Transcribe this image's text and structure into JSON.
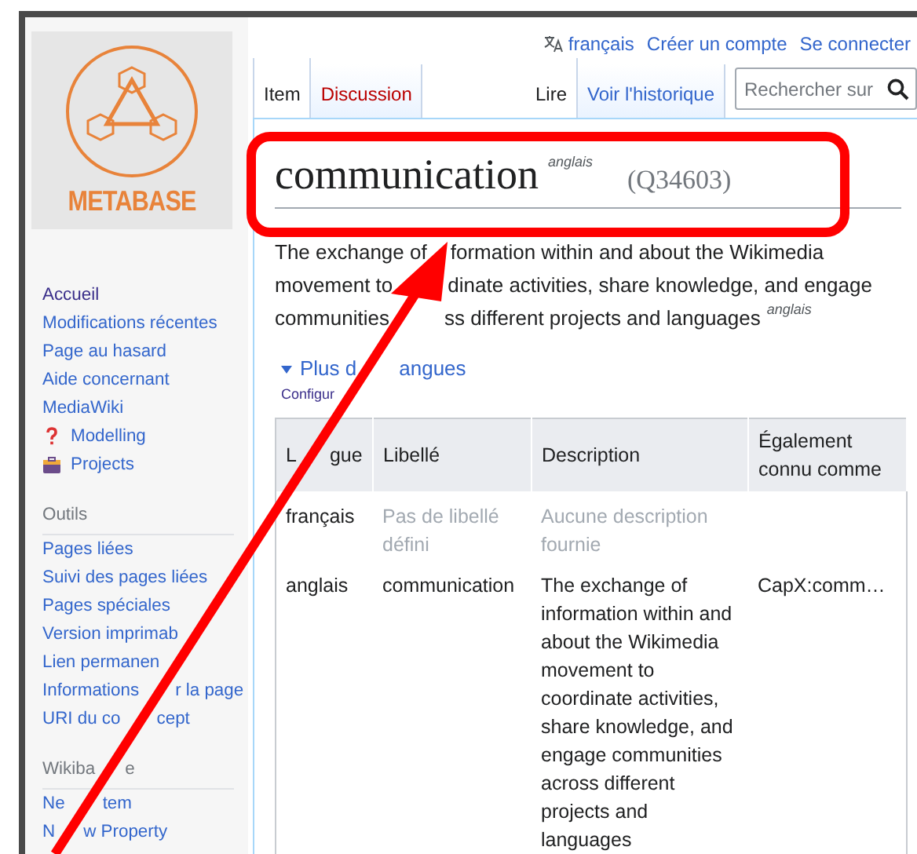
{
  "header_links": [
    {
      "kind": "language",
      "label": "français"
    },
    {
      "kind": "link",
      "label": "Créer un compte"
    },
    {
      "kind": "link",
      "label": "Se connecter"
    }
  ],
  "logo": {
    "text": "METABASE"
  },
  "sidebar": {
    "navigation": [
      {
        "label": "Accueil",
        "visited": true,
        "kind": "link"
      },
      {
        "label": "Modifications récentes",
        "visited": false,
        "kind": "link"
      },
      {
        "label": "Page au hasard",
        "visited": false,
        "kind": "link"
      },
      {
        "label": "Aide concernant MediaWiki",
        "visited": false,
        "kind": "link"
      },
      {
        "label": "Modelling",
        "visited": false,
        "kind": "question"
      },
      {
        "label": "Projects",
        "visited": false,
        "kind": "toolbox"
      }
    ],
    "sections": [
      {
        "title": {
          "parts": [
            "Outils"
          ]
        },
        "items": [
          {
            "parts": [
              "Pages liées"
            ]
          },
          {
            "parts": [
              "Suivi des pages liées"
            ]
          },
          {
            "parts": [
              "Pages spéciales"
            ]
          },
          {
            "parts": [
              "Version imprimab"
            ]
          },
          {
            "parts": [
              "Lien permanen"
            ]
          },
          {
            "parts": [
              "Informations",
              "r la page"
            ]
          },
          {
            "parts": [
              "URI du co",
              "cept"
            ]
          }
        ]
      },
      {
        "title": {
          "parts": [
            "Wikiba",
            "e"
          ]
        },
        "items": [
          {
            "parts": [
              "Ne",
              "tem"
            ]
          },
          {
            "parts": [
              "N",
              "w Property"
            ]
          }
        ]
      }
    ]
  },
  "tabs_left": [
    {
      "label": "Item",
      "selected": true,
      "missing": false
    },
    {
      "label": "Discussion",
      "selected": false,
      "missing": true
    }
  ],
  "tabs_right": [
    {
      "label": "Lire",
      "selected": true
    },
    {
      "label": "Voir l'historique",
      "selected": false
    }
  ],
  "search": {
    "placeholder": "Rechercher sur"
  },
  "title": {
    "label": "communication",
    "language": "anglais",
    "id": "(Q34603)"
  },
  "description": {
    "lines": [
      {
        "parts": [
          "The exchange of",
          "formation within and about the Wikimedia"
        ]
      },
      {
        "parts": [
          "movement to",
          "dinate activities, share knowledge, and engage"
        ]
      },
      {
        "parts": [
          "communities",
          "ss different projects and languages"
        ]
      }
    ],
    "language": "anglais"
  },
  "more_languages": {
    "parts": [
      "Plus d",
      "angues"
    ],
    "expanded": true,
    "configure": "Configur"
  },
  "table": {
    "columns": [
      {
        "parts": [
          "L",
          "gue"
        ]
      },
      {
        "parts": [
          "Libellé"
        ]
      },
      {
        "parts": [
          "Description"
        ]
      },
      {
        "parts": [
          "Également connu comme"
        ]
      }
    ],
    "rows": [
      {
        "language": "français",
        "label": "Pas de libellé défini",
        "label_missing": true,
        "description": "Aucune description fournie",
        "description_missing": true
      },
      {
        "language": "anglais",
        "label": "communication",
        "label_missing": false,
        "description": "The exchange of information within and about the Wikimedia movement to coordinate activities, share knowledge, and engage communities across different projects and languages",
        "description_missing": false,
        "aliases": "CapX:comm…"
      }
    ]
  }
}
